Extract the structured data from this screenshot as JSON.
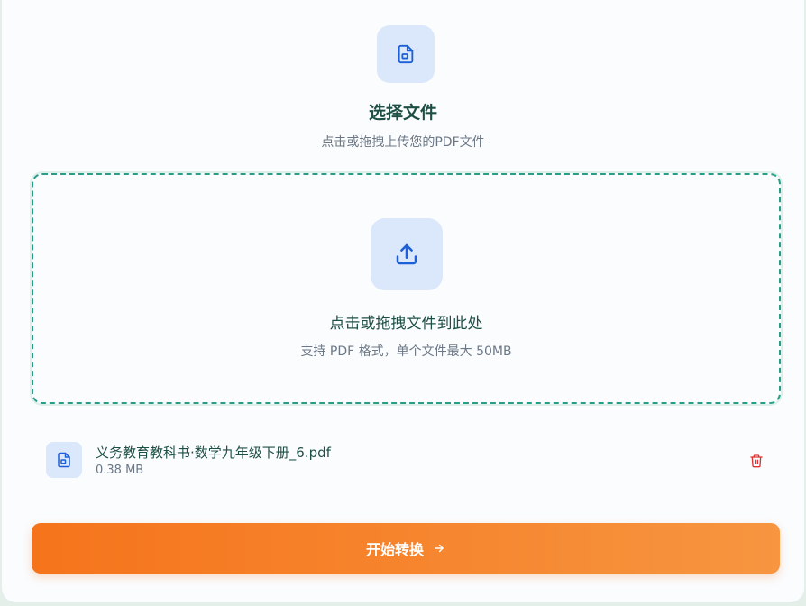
{
  "header": {
    "icon": "file-icon",
    "title": "选择文件",
    "subtitle": "点击或拖拽上传您的PDF文件"
  },
  "dropzone": {
    "icon": "upload-icon",
    "title": "点击或拖拽文件到此处",
    "hint": "支持 PDF 格式，单个文件最大 50MB"
  },
  "file": {
    "icon": "pdf-file-icon",
    "name": "义务教育教科书·数学九年级下册_6.pdf",
    "size": "0.38 MB",
    "delete_icon": "trash-icon"
  },
  "actions": {
    "convert_label": "开始转换",
    "convert_icon": "arrow-right-icon"
  },
  "colors": {
    "accent_green": "#2a9d86",
    "accent_blue": "#1d5fd6",
    "button_orange": "#f5741b",
    "delete_red": "#e03131"
  }
}
